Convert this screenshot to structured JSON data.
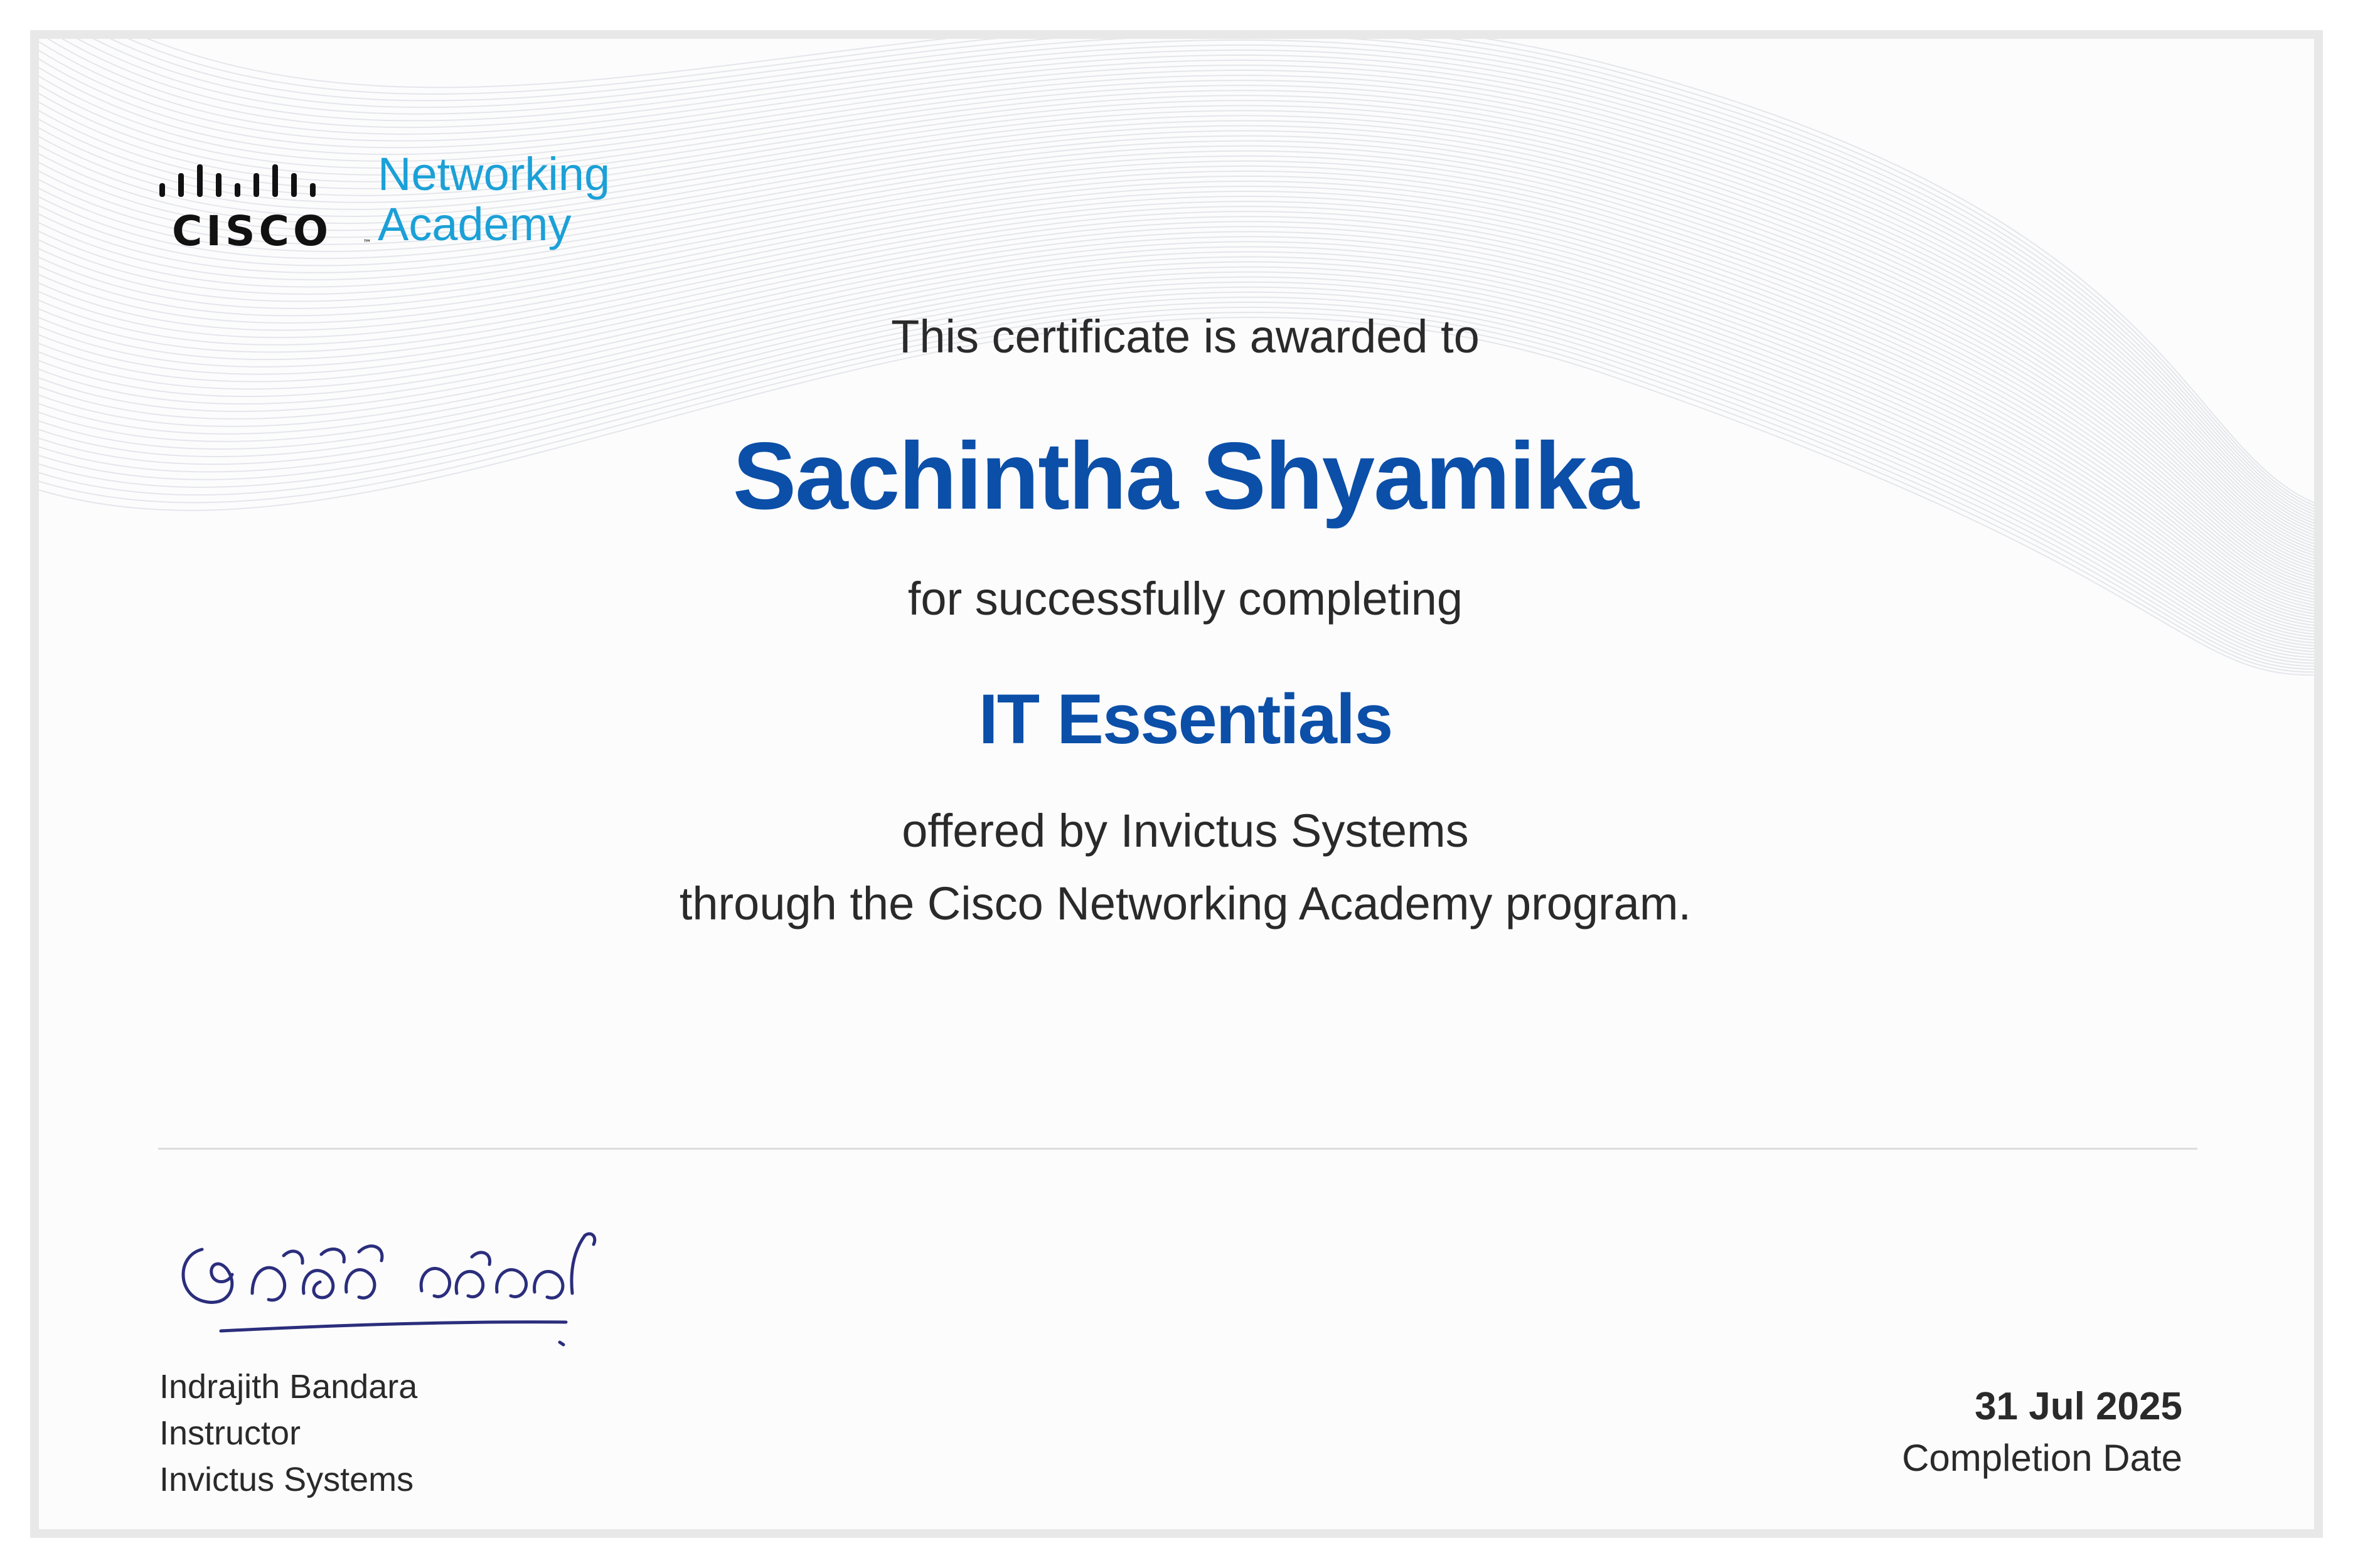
{
  "logo": {
    "brand_word": "CISCO",
    "brand_tm": "™",
    "academy_line1": "Networking",
    "academy_line2": "Academy",
    "brand_color": "#111111",
    "academy_color": "#1ba0d7"
  },
  "certificate": {
    "awarded_to_label": "This certificate is awarded to",
    "recipient_name": "Sachintha Shyamika",
    "completing_label": "for successfully completing",
    "course_name": "IT Essentials",
    "offered_by_line": "offered by Invictus Systems",
    "program_line": "through the Cisco Networking Academy program.",
    "accent_color": "#0b4fa8"
  },
  "signatory": {
    "name": "Indrajith Bandara",
    "title": "Instructor",
    "organization": "Invictus Systems",
    "signature_ink_color": "#2b2e7c"
  },
  "completion": {
    "date": "31 Jul 2025",
    "label": "Completion Date"
  }
}
